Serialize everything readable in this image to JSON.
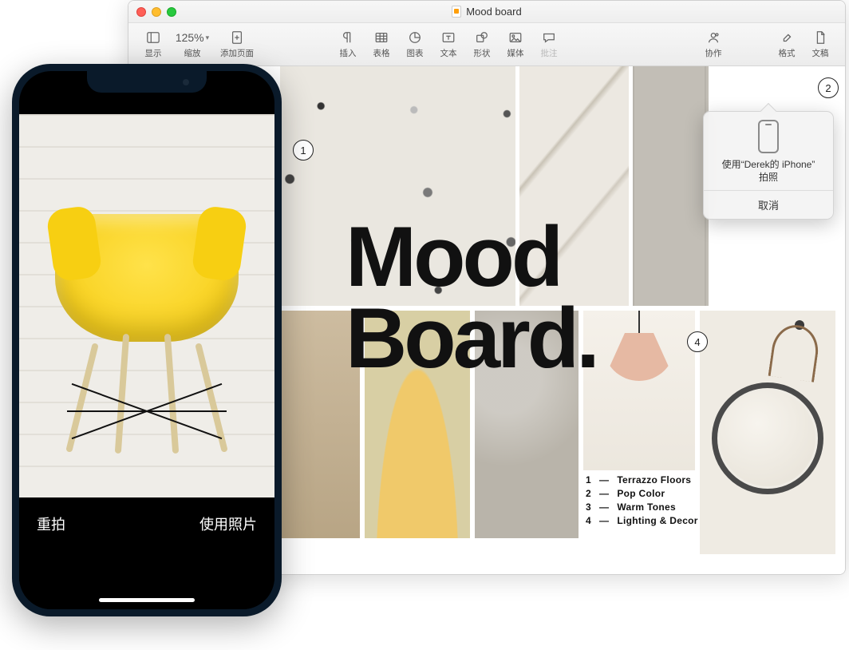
{
  "window": {
    "title": "Mood board"
  },
  "toolbar": {
    "view": "显示",
    "zoom": "缩放",
    "zoom_value": "125%",
    "add_page": "添加页面",
    "insert": "插入",
    "table": "表格",
    "chart": "图表",
    "text": "文本",
    "shape": "形状",
    "media": "媒体",
    "comment": "批注",
    "collaborate": "协作",
    "format": "格式",
    "document": "文稿"
  },
  "document": {
    "headline": "Mood\nBoard.",
    "headline_l1": "Mood",
    "headline_l2": "Board.",
    "legend": [
      {
        "n": "1",
        "label": "Terrazzo Floors"
      },
      {
        "n": "2",
        "label": "Pop Color"
      },
      {
        "n": "3",
        "label": "Warm Tones"
      },
      {
        "n": "4",
        "label": "Lighting & Decor"
      }
    ],
    "callouts": {
      "c1": "1",
      "c2": "2",
      "c4": "4"
    }
  },
  "popover": {
    "line1": "使用“Derek的 iPhone”",
    "line2": "拍照",
    "cancel": "取消"
  },
  "iphone": {
    "retake": "重拍",
    "use_photo": "使用照片"
  }
}
